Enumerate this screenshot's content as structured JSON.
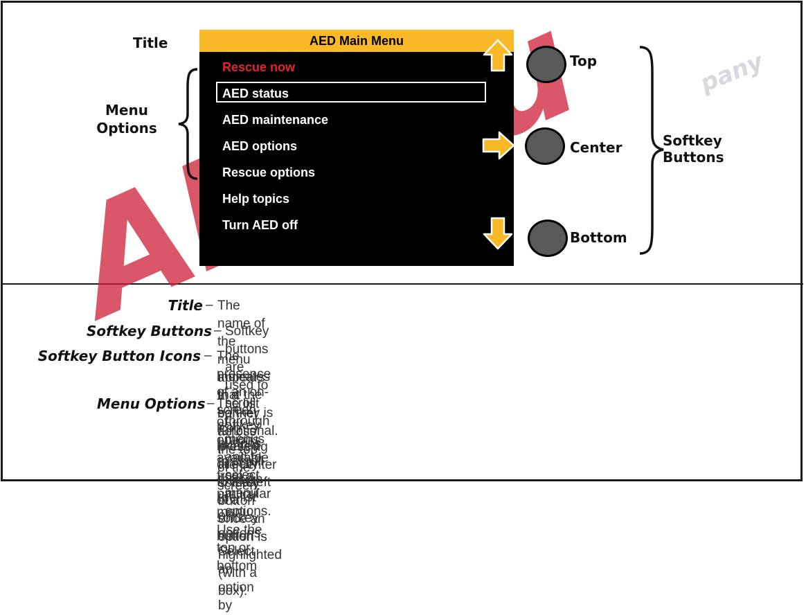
{
  "diagram": {
    "labels": {
      "title": "Title",
      "menu_options_line1": "Menu",
      "menu_options_line2": "Options",
      "softkey_line1": "Softkey",
      "softkey_line2": "Buttons"
    },
    "screen": {
      "title": "AED Main Menu",
      "items": [
        {
          "label": "Rescue now",
          "color": "#e5232b"
        },
        {
          "label": "AED status",
          "highlighted": true
        },
        {
          "label": "AED maintenance"
        },
        {
          "label": "AED options"
        },
        {
          "label": "Rescue options"
        },
        {
          "label": "Help topics"
        },
        {
          "label": "Turn AED off"
        }
      ],
      "colors": {
        "banner": "#f8b827",
        "background": "#000000",
        "accent_red": "#e5232b"
      }
    },
    "softkeys": [
      {
        "label": "Top",
        "icon": "arrow-up-icon"
      },
      {
        "label": "Center",
        "icon": "arrow-right-icon"
      },
      {
        "label": "Bottom",
        "icon": "arrow-down-icon"
      }
    ]
  },
  "descriptions": [
    {
      "term": "Title",
      "sep": "–",
      "text": "The name of the menu appears in a banner across the top of the screen."
    },
    {
      "term": "Softkey Buttons",
      "sep": "–",
      "text": "Softkey buttons are used to scroll through menus and to select menu options."
    },
    {
      "term": "Softkey Button Icons",
      "sep": "–",
      "text_lines": [
        "The presence of an on-screen icon located directly to the left of a softkey button",
        "indicates that the softkey is functional."
      ]
    },
    {
      "term": "Menu Options",
      "sep": "–",
      "text_lines": [
        "The list of options available from a particular menu. Use the top or bottom",
        "softkey buttons to scroll through the list of options. Select an option by",
        "pressing the center softkey button once an option is highlighted (with a box)."
      ]
    }
  ],
  "watermark": {
    "text": "AEDSu",
    "tail": "pany"
  }
}
